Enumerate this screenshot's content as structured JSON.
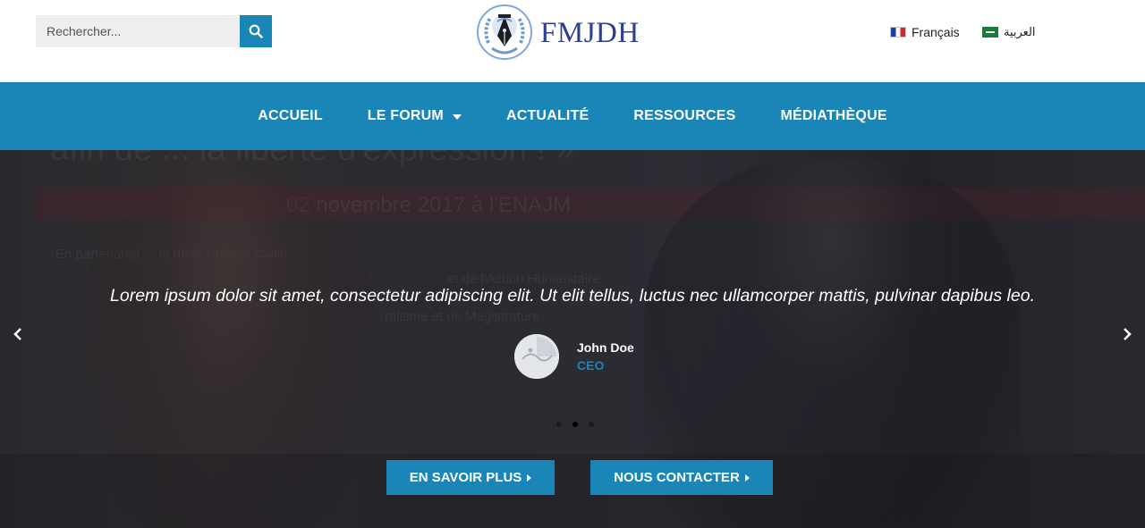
{
  "header": {
    "search": {
      "placeholder": "Rechercher...",
      "button_icon": "search-icon"
    },
    "logo": {
      "text": "FMJDH",
      "icon": "un-wreath-pen-icon"
    },
    "languages": [
      {
        "label": "Français",
        "flag": "france-flag-icon"
      },
      {
        "label": "العربية",
        "flag": "saudi-flag-icon"
      }
    ]
  },
  "nav": {
    "items": [
      {
        "label": "ACCUEIL"
      },
      {
        "label": "LE FORUM",
        "has_dropdown": true
      },
      {
        "label": "ACTUALITÉ"
      },
      {
        "label": "RESSOURCES"
      },
      {
        "label": "MÉDIATHÈQUE"
      }
    ]
  },
  "hero": {
    "background_text": {
      "line1": "afin de ... la liberté d'expression ! »",
      "line2": "02 novembre 2017 à l'ENAJM",
      "line3": "En partenariat ... et de la Société Civile",
      "line4": "et de l'Action Humanitaire",
      "line5": "ralisme et de Magistrature"
    },
    "testimonial": {
      "quote": "Lorem ipsum dolor sit amet, consectetur adipiscing elit. Ut elit tellus, luctus nec ullamcorper mattis, pulvinar dapibus leo.",
      "name": "John Doe",
      "role": "CEO"
    },
    "slides_count": 3,
    "active_slide": 2,
    "buttons": {
      "more": "EN SAVOIR PLUS",
      "contact": "NOUS CONTACTER"
    }
  },
  "colors": {
    "accent": "#1a86b8",
    "logo": "#2f3f8f"
  }
}
